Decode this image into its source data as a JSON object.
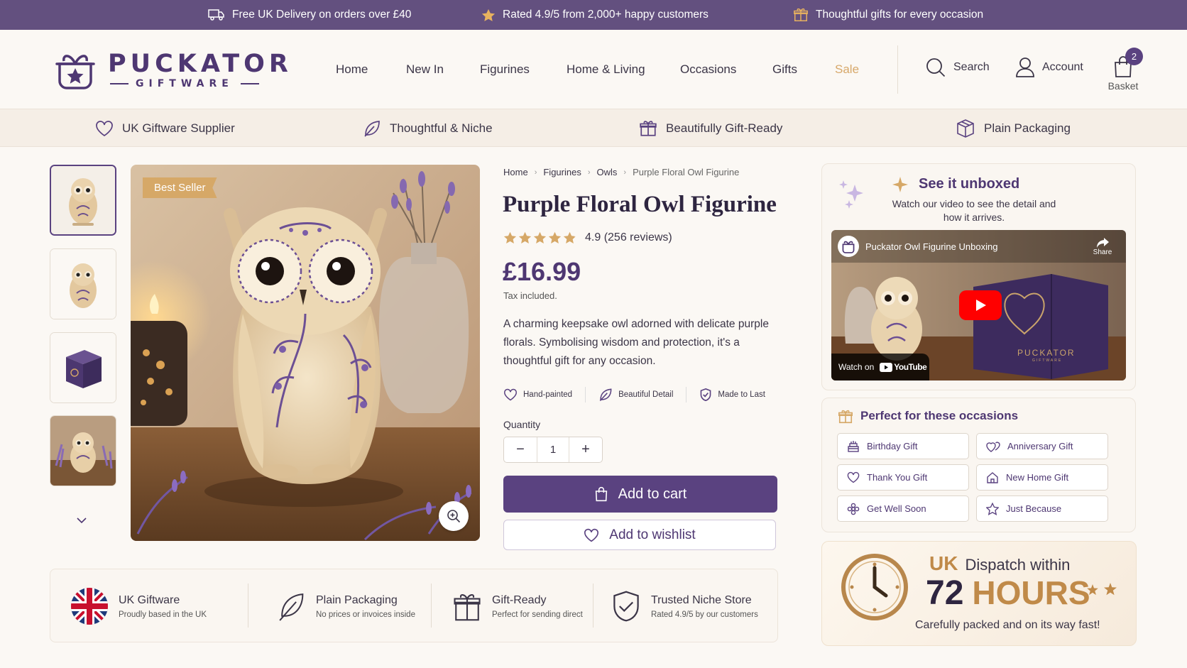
{
  "topbar": {
    "delivery": "Free UK Delivery on orders over £40",
    "rating": "Rated 4.9/5 from 2,000+ happy customers",
    "gifts": "Thoughtful gifts for every occasion"
  },
  "brand": {
    "name": "PUCKATOR",
    "sub": "GIFTWARE"
  },
  "nav": [
    "Home",
    "New In",
    "Figurines",
    "Home & Living",
    "Occasions",
    "Gifts",
    "Sale"
  ],
  "utility": {
    "search": "Search",
    "account": "Account",
    "basket": "Basket",
    "basket_count": "2"
  },
  "usp": [
    "UK Giftware Supplier",
    "Thoughtful & Niche",
    "Beautifully Gift-Ready",
    "Plain Packaging"
  ],
  "gallery": {
    "badge": "Best Seller"
  },
  "breadcrumb": [
    "Home",
    "Figurines",
    "Owls",
    "Purple Floral Owl Figurine"
  ],
  "product": {
    "title": "Purple Floral Owl Figurine",
    "rating_text": "4.9 (256 reviews)",
    "rating_value": 4.9,
    "price": "£16.99",
    "tax": "Tax included.",
    "description": "A charming keepsake owl adorned with delicate purple florals. Symbolising wisdom and protection, it's a thoughtful gift for any occasion.",
    "features": [
      "Hand-painted",
      "Beautiful Detail",
      "Made to Last"
    ],
    "quantity_label": "Quantity",
    "quantity": "1",
    "add_to_cart": "Add to cart",
    "add_to_wishlist": "Add to wishlist"
  },
  "trust": [
    {
      "title": "UK Giftware",
      "sub": "Proudly based in the UK"
    },
    {
      "title": "Plain Packaging",
      "sub": "No prices or invoices inside"
    },
    {
      "title": "Gift-Ready",
      "sub": "Perfect for sending direct"
    },
    {
      "title": "Trusted Niche Store",
      "sub": "Rated 4.9/5 by our customers"
    }
  ],
  "unboxed": {
    "title": "See it unboxed",
    "subtitle": "Watch our video to see the detail and how it arrives.",
    "video_title": "Puckator Owl Figurine Unboxing",
    "share": "Share",
    "watch_on": "Watch on",
    "youtube": "YouTube",
    "box_brand": "PUCKATOR",
    "box_sub": "GIFTWARE"
  },
  "occasions": {
    "title": "Perfect for these occasions",
    "items": [
      "Birthday Gift",
      "Anniversary Gift",
      "Thank You Gift",
      "New Home Gift",
      "Get Well Soon",
      "Just Because"
    ]
  },
  "dispatch": {
    "uk": "UK",
    "within": "Dispatch within",
    "number": "72",
    "unit": "HOURS",
    "note": "Carefully packed and on its way fast!"
  },
  "colors": {
    "brand_purple": "#5a4280",
    "topbar": "#63507f",
    "gold": "#c08a49",
    "sale": "#d7a86a"
  }
}
